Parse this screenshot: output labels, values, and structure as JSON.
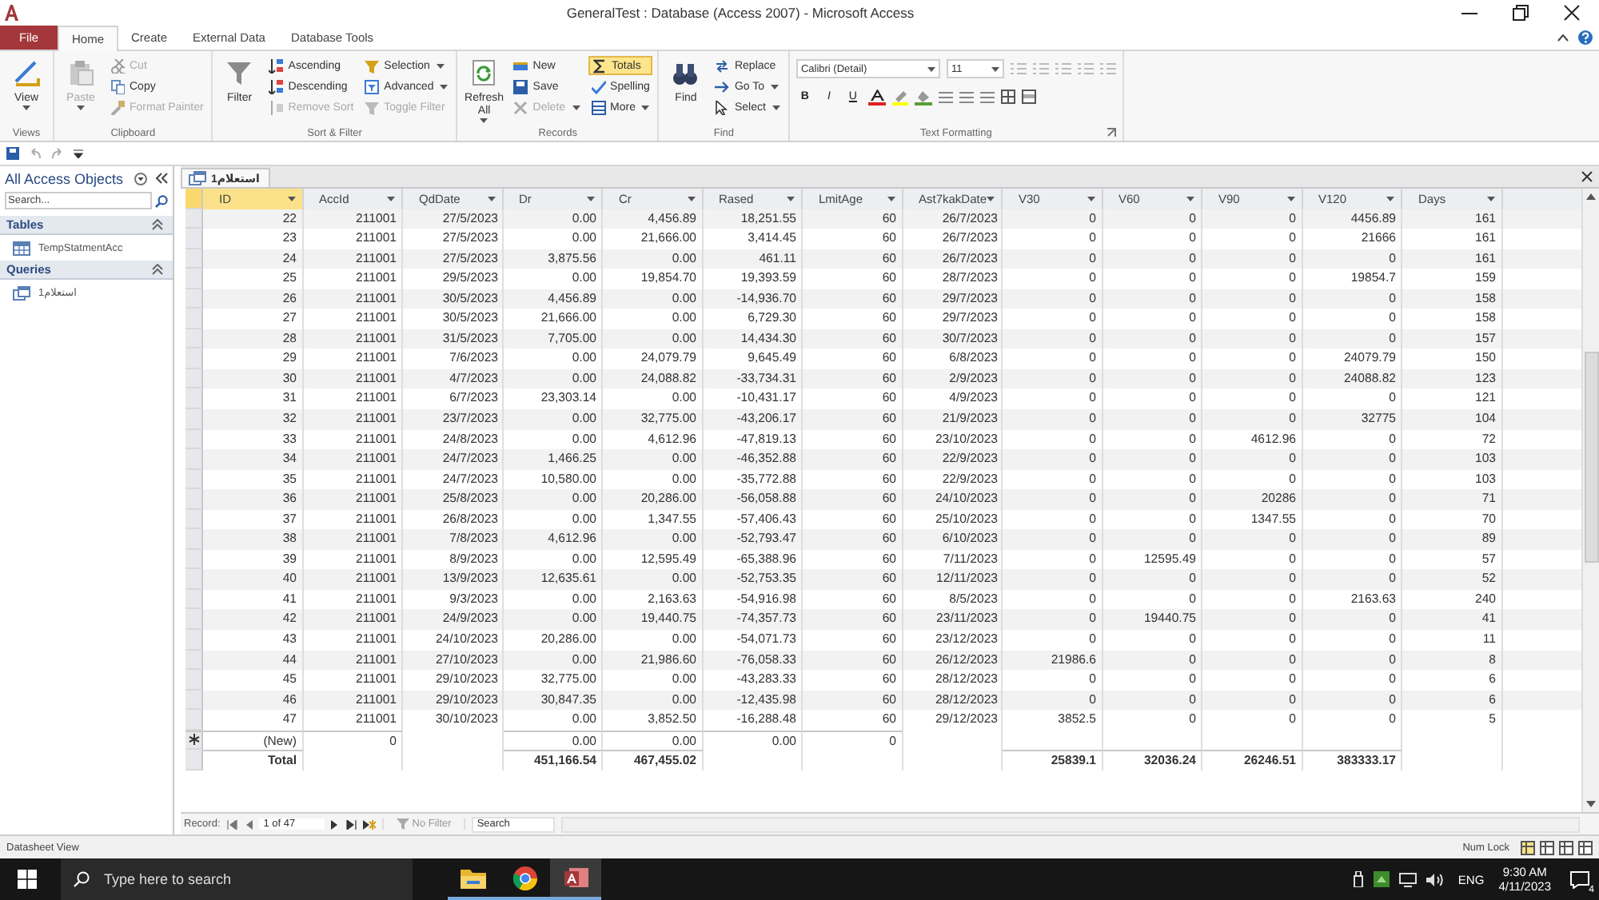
{
  "window": {
    "title": "GeneralTest : Database (Access 2007) - Microsoft Access"
  },
  "ribbon_tabs": [
    {
      "label": "File",
      "kind": "file",
      "selected": false
    },
    {
      "label": "Home",
      "kind": "tab",
      "selected": true
    },
    {
      "label": "Create",
      "kind": "tab",
      "selected": false
    },
    {
      "label": "External Data",
      "kind": "tab",
      "selected": false
    },
    {
      "label": "Database Tools",
      "kind": "tab",
      "selected": false
    }
  ],
  "ribbon_groups": [
    {
      "label": "Views",
      "items": [
        {
          "label": "View",
          "kind": "large",
          "disabled": false,
          "dropdown": true
        }
      ]
    },
    {
      "label": "Clipboard",
      "items": [
        {
          "label": "Paste",
          "kind": "large",
          "disabled": true,
          "dropdown": true
        },
        {
          "label": "Cut",
          "kind": "small",
          "disabled": true
        },
        {
          "label": "Copy",
          "kind": "small",
          "disabled": false
        },
        {
          "label": "Format Painter",
          "kind": "small",
          "disabled": true
        }
      ]
    },
    {
      "label": "Sort & Filter",
      "items": [
        {
          "label": "Filter",
          "kind": "large",
          "disabled": false
        },
        {
          "label": "Ascending",
          "kind": "small",
          "disabled": false
        },
        {
          "label": "Descending",
          "kind": "small",
          "disabled": false
        },
        {
          "label": "Remove Sort",
          "kind": "small",
          "disabled": true
        },
        {
          "label": "Selection",
          "kind": "small",
          "disabled": false,
          "dropdown": true
        },
        {
          "label": "Advanced",
          "kind": "small",
          "disabled": false,
          "dropdown": true
        },
        {
          "label": "Toggle Filter",
          "kind": "small",
          "disabled": true
        }
      ]
    },
    {
      "label": "Records",
      "items": [
        {
          "label": "Refresh All",
          "kind": "large",
          "disabled": false,
          "dropdown": true
        },
        {
          "label": "New",
          "kind": "small",
          "disabled": false
        },
        {
          "label": "Save",
          "kind": "small",
          "disabled": false
        },
        {
          "label": "Delete",
          "kind": "small",
          "disabled": true,
          "dropdown": true
        },
        {
          "label": "Totals",
          "kind": "toggle",
          "disabled": false,
          "on": true
        },
        {
          "label": "Spelling",
          "kind": "small",
          "disabled": false
        },
        {
          "label": "More",
          "kind": "small",
          "disabled": false,
          "dropdown": true
        }
      ]
    },
    {
      "label": "Find",
      "items": [
        {
          "label": "Find",
          "kind": "large",
          "disabled": false
        },
        {
          "label": "Replace",
          "kind": "small",
          "disabled": false
        },
        {
          "label": "Go To",
          "kind": "small",
          "disabled": false,
          "dropdown": true
        },
        {
          "label": "Select",
          "kind": "small",
          "disabled": false,
          "dropdown": true
        }
      ]
    }
  ],
  "text_formatting": {
    "label": "Text Formatting",
    "font": "Calibri (Detail)",
    "size": "11",
    "format_buttons": [
      "B",
      "I",
      "U"
    ]
  },
  "nav_pane": {
    "title": "All Access Objects",
    "search": {
      "placeholder": "Search..."
    },
    "groups": [
      {
        "label": "Tables",
        "kind": "table",
        "expanded": true,
        "items": [
          "TempStatmentAcc"
        ]
      },
      {
        "label": "Queries",
        "kind": "query",
        "expanded": true,
        "items": [
          "استعلام1"
        ]
      }
    ]
  },
  "document_tab": {
    "label": "استعلام1"
  },
  "datasheet": {
    "columns": [
      {
        "label": "ID",
        "selected": true
      },
      {
        "label": "AccId",
        "selected": false
      },
      {
        "label": "QdDate",
        "selected": false
      },
      {
        "label": "Dr",
        "selected": false
      },
      {
        "label": "Cr",
        "selected": false
      },
      {
        "label": "Rased",
        "selected": false
      },
      {
        "label": "LmitAge",
        "selected": false
      },
      {
        "label": "Ast7kakDate",
        "selected": false
      },
      {
        "label": "V30",
        "selected": false
      },
      {
        "label": "V60",
        "selected": false
      },
      {
        "label": "V90",
        "selected": false
      },
      {
        "label": "V120",
        "selected": false
      },
      {
        "label": "Days",
        "selected": false
      }
    ],
    "rows": [
      {
        "kind": "record",
        "cells": [
          "22",
          "211001",
          "27/5/2023",
          "0.00",
          "4,456.89",
          "18,251.55",
          "60",
          "26/7/2023",
          "0",
          "0",
          "0",
          "4456.89",
          "161"
        ]
      },
      {
        "kind": "record",
        "cells": [
          "23",
          "211001",
          "27/5/2023",
          "0.00",
          "21,666.00",
          "3,414.45",
          "60",
          "26/7/2023",
          "0",
          "0",
          "0",
          "21666",
          "161"
        ]
      },
      {
        "kind": "record",
        "cells": [
          "24",
          "211001",
          "27/5/2023",
          "3,875.56",
          "0.00",
          "461.11",
          "60",
          "26/7/2023",
          "0",
          "0",
          "0",
          "0",
          "161"
        ]
      },
      {
        "kind": "record",
        "cells": [
          "25",
          "211001",
          "29/5/2023",
          "0.00",
          "19,854.70",
          "19,393.59",
          "60",
          "28/7/2023",
          "0",
          "0",
          "0",
          "19854.7",
          "159"
        ]
      },
      {
        "kind": "record",
        "cells": [
          "26",
          "211001",
          "30/5/2023",
          "4,456.89",
          "0.00",
          "-14,936.70",
          "60",
          "29/7/2023",
          "0",
          "0",
          "0",
          "0",
          "158"
        ]
      },
      {
        "kind": "record",
        "cells": [
          "27",
          "211001",
          "30/5/2023",
          "21,666.00",
          "0.00",
          "6,729.30",
          "60",
          "29/7/2023",
          "0",
          "0",
          "0",
          "0",
          "158"
        ]
      },
      {
        "kind": "record",
        "cells": [
          "28",
          "211001",
          "31/5/2023",
          "7,705.00",
          "0.00",
          "14,434.30",
          "60",
          "30/7/2023",
          "0",
          "0",
          "0",
          "0",
          "157"
        ]
      },
      {
        "kind": "record",
        "cells": [
          "29",
          "211001",
          "7/6/2023",
          "0.00",
          "24,079.79",
          "9,645.49",
          "60",
          "6/8/2023",
          "0",
          "0",
          "0",
          "24079.79",
          "150"
        ]
      },
      {
        "kind": "record",
        "cells": [
          "30",
          "211001",
          "4/7/2023",
          "0.00",
          "24,088.82",
          "-33,734.31",
          "60",
          "2/9/2023",
          "0",
          "0",
          "0",
          "24088.82",
          "123"
        ]
      },
      {
        "kind": "record",
        "cells": [
          "31",
          "211001",
          "6/7/2023",
          "23,303.14",
          "0.00",
          "-10,431.17",
          "60",
          "4/9/2023",
          "0",
          "0",
          "0",
          "0",
          "121"
        ]
      },
      {
        "kind": "record",
        "cells": [
          "32",
          "211001",
          "23/7/2023",
          "0.00",
          "32,775.00",
          "-43,206.17",
          "60",
          "21/9/2023",
          "0",
          "0",
          "0",
          "32775",
          "104"
        ]
      },
      {
        "kind": "record",
        "cells": [
          "33",
          "211001",
          "24/8/2023",
          "0.00",
          "4,612.96",
          "-47,819.13",
          "60",
          "23/10/2023",
          "0",
          "0",
          "4612.96",
          "0",
          "72"
        ]
      },
      {
        "kind": "record",
        "cells": [
          "34",
          "211001",
          "24/7/2023",
          "1,466.25",
          "0.00",
          "-46,352.88",
          "60",
          "22/9/2023",
          "0",
          "0",
          "0",
          "0",
          "103"
        ]
      },
      {
        "kind": "record",
        "cells": [
          "35",
          "211001",
          "24/7/2023",
          "10,580.00",
          "0.00",
          "-35,772.88",
          "60",
          "22/9/2023",
          "0",
          "0",
          "0",
          "0",
          "103"
        ]
      },
      {
        "kind": "record",
        "cells": [
          "36",
          "211001",
          "25/8/2023",
          "0.00",
          "20,286.00",
          "-56,058.88",
          "60",
          "24/10/2023",
          "0",
          "0",
          "20286",
          "0",
          "71"
        ]
      },
      {
        "kind": "record",
        "cells": [
          "37",
          "211001",
          "26/8/2023",
          "0.00",
          "1,347.55",
          "-57,406.43",
          "60",
          "25/10/2023",
          "0",
          "0",
          "1347.55",
          "0",
          "70"
        ]
      },
      {
        "kind": "record",
        "cells": [
          "38",
          "211001",
          "7/8/2023",
          "4,612.96",
          "0.00",
          "-52,793.47",
          "60",
          "6/10/2023",
          "0",
          "0",
          "0",
          "0",
          "89"
        ]
      },
      {
        "kind": "record",
        "cells": [
          "39",
          "211001",
          "8/9/2023",
          "0.00",
          "12,595.49",
          "-65,388.96",
          "60",
          "7/11/2023",
          "0",
          "12595.49",
          "0",
          "0",
          "57"
        ]
      },
      {
        "kind": "record",
        "cells": [
          "40",
          "211001",
          "13/9/2023",
          "12,635.61",
          "0.00",
          "-52,753.35",
          "60",
          "12/11/2023",
          "0",
          "0",
          "0",
          "0",
          "52"
        ]
      },
      {
        "kind": "record",
        "cells": [
          "41",
          "211001",
          "9/3/2023",
          "0.00",
          "2,163.63",
          "-54,916.98",
          "60",
          "8/5/2023",
          "0",
          "0",
          "0",
          "2163.63",
          "240"
        ]
      },
      {
        "kind": "record",
        "cells": [
          "42",
          "211001",
          "24/9/2023",
          "0.00",
          "19,440.75",
          "-74,357.73",
          "60",
          "23/11/2023",
          "0",
          "19440.75",
          "0",
          "0",
          "41"
        ]
      },
      {
        "kind": "record",
        "cells": [
          "43",
          "211001",
          "24/10/2023",
          "20,286.00",
          "0.00",
          "-54,071.73",
          "60",
          "23/12/2023",
          "0",
          "0",
          "0",
          "0",
          "11"
        ]
      },
      {
        "kind": "record",
        "cells": [
          "44",
          "211001",
          "27/10/2023",
          "0.00",
          "21,986.60",
          "-76,058.33",
          "60",
          "26/12/2023",
          "21986.6",
          "0",
          "0",
          "0",
          "8"
        ]
      },
      {
        "kind": "record",
        "cells": [
          "45",
          "211001",
          "29/10/2023",
          "32,775.00",
          "0.00",
          "-43,283.33",
          "60",
          "28/12/2023",
          "0",
          "0",
          "0",
          "0",
          "6"
        ]
      },
      {
        "kind": "record",
        "cells": [
          "46",
          "211001",
          "29/10/2023",
          "30,847.35",
          "0.00",
          "-12,435.98",
          "60",
          "28/12/2023",
          "0",
          "0",
          "0",
          "0",
          "6"
        ]
      },
      {
        "kind": "record",
        "cells": [
          "47",
          "211001",
          "30/10/2023",
          "0.00",
          "3,852.50",
          "-16,288.48",
          "60",
          "29/12/2023",
          "3852.5",
          "0",
          "0",
          "0",
          "5"
        ]
      },
      {
        "kind": "new",
        "cells": [
          "(New)",
          "0",
          null,
          "0.00",
          "0.00",
          "0.00",
          "0",
          null,
          null,
          null,
          null,
          null,
          null
        ]
      },
      {
        "kind": "total",
        "cells": [
          "Total",
          null,
          null,
          "451,166.54",
          "467,455.02",
          null,
          null,
          null,
          "25839.1",
          "32036.24",
          "26246.51",
          "383333.17",
          null
        ]
      }
    ]
  },
  "record_nav": {
    "label": "Record:",
    "position": "1 of 47",
    "filter": "No Filter",
    "search": {
      "placeholder": "Search"
    }
  },
  "status_bar": {
    "left": "Datasheet View",
    "right": "Num Lock"
  },
  "taskbar": {
    "search": {
      "placeholder": "Type here to search"
    },
    "language": "ENG",
    "time": "9:30 AM",
    "date": "4/11/2023",
    "notifications": "4"
  }
}
